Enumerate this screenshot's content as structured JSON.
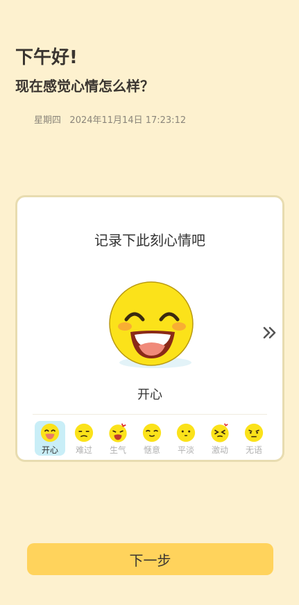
{
  "header": {
    "greeting": "下午好!",
    "question": "现在感觉心情怎么样？",
    "weekday": "星期四",
    "datetime": "2024年11月14日 17:23:12"
  },
  "card": {
    "title": "记录下此刻心情吧",
    "selected_mood": "开心",
    "moods": [
      {
        "label": "开心",
        "icon": "laughing-face-icon"
      },
      {
        "label": "难过",
        "icon": "sad-face-icon"
      },
      {
        "label": "生气",
        "icon": "angry-face-icon"
      },
      {
        "label": "惬意",
        "icon": "content-face-icon"
      },
      {
        "label": "平淡",
        "icon": "neutral-face-icon"
      },
      {
        "label": "激动",
        "icon": "excited-face-icon"
      },
      {
        "label": "无语",
        "icon": "speechless-face-icon"
      }
    ]
  },
  "footer": {
    "next_label": "下一步"
  },
  "colors": {
    "background": "#fdf1cf",
    "accent": "#ffd35c",
    "selected": "#c9eef7"
  }
}
